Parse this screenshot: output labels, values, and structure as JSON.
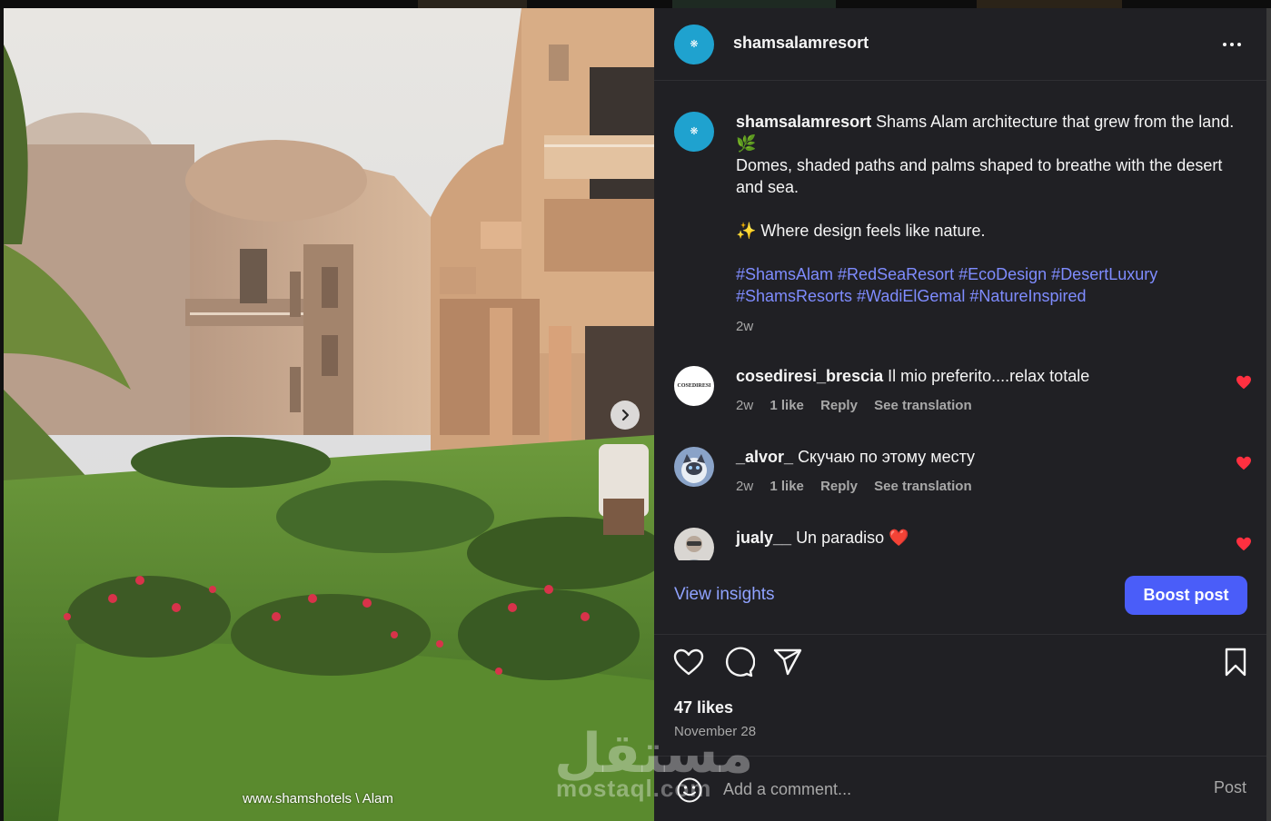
{
  "colors": {
    "panel_bg": "#202024",
    "accent_blue": "#4a5df9",
    "link_blue": "#8fa2ff",
    "hashtag_blue": "#7f8cff",
    "heart_red": "#ff3040",
    "avatar_teal": "#1fa2cf"
  },
  "photo": {
    "watermark_caption": "www.shamshotels \\ Alam",
    "next_icon": "chevron-right-icon"
  },
  "header": {
    "username": "shamsalamresort",
    "more_icon": "more-horizontal-icon"
  },
  "post_caption": {
    "username": "shamsalamresort",
    "line1": "Shams Alam architecture that grew from the land.",
    "line1_emoji": "🌿",
    "line2": "Domes, shaded paths and palms shaped to breathe with the desert and sea.",
    "line3_emoji": "✨",
    "line3": " Where design feels like nature.",
    "hashtags_line1": "#ShamsAlam #RedSeaResort #EcoDesign #DesertLuxury",
    "hashtags_line2": "#ShamsResorts #WadiElGemal #NatureInspired",
    "time": "2w"
  },
  "comments": [
    {
      "username": "cosediresi_brescia",
      "text": "Il mio preferito....relax totale",
      "time": "2w",
      "likes": "1 like",
      "reply": "Reply",
      "translate": "See translation",
      "avatar_label": "COSEDIRESI"
    },
    {
      "username": "_alvor_",
      "text": "Скучаю по этому месту",
      "time": "2w",
      "likes": "1 like",
      "reply": "Reply",
      "translate": "See translation"
    },
    {
      "username": "jualy__",
      "text": "Un paradiso",
      "text_emoji": "❤️"
    }
  ],
  "footer": {
    "view_insights": "View insights",
    "boost_post": "Boost post",
    "likes": "47 likes",
    "date": "November 28",
    "add_comment_placeholder": "Add a comment...",
    "post_label": "Post"
  },
  "watermark": {
    "arabic": "مستقل",
    "latin": "mostaql.com"
  }
}
